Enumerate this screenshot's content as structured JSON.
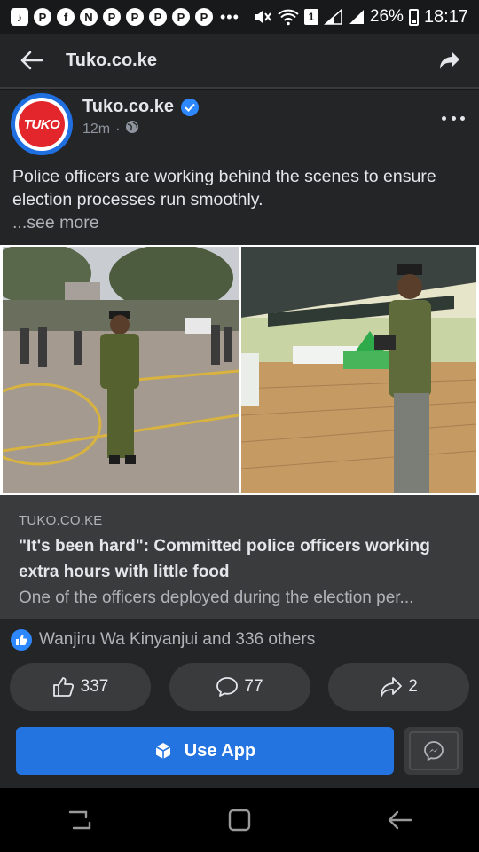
{
  "status_bar": {
    "left_icons": [
      "tiktok-icon",
      "p-icon",
      "facebook-icon",
      "n-icon",
      "p-icon",
      "p-icon",
      "p-icon",
      "p-icon",
      "p-icon"
    ],
    "overflow": "•••",
    "sim": "1",
    "battery": "26%",
    "time": "18:17"
  },
  "header": {
    "title": "Tuko.co.ke"
  },
  "post": {
    "avatar_text": "TUKO",
    "page_name": "Tuko.co.ke",
    "time": "12m",
    "caption": "Police officers are working behind the scenes to ensure election processes run smoothly.",
    "see_more": "...see more",
    "link": {
      "domain": "TUKO.CO.KE",
      "title": "\"It's been hard\": Committed police officers working extra hours with little food",
      "description": "One of the officers deployed during the election per..."
    },
    "reactions_text": "Wanjiru Wa Kinyanjui and 336 others",
    "likes": "337",
    "comments": "77",
    "shares": "2"
  },
  "app_bar": {
    "use_app_label": "Use App"
  },
  "colors": {
    "background": "#18191a",
    "surface": "#242526",
    "button": "#3a3b3c",
    "accent": "#2374e1",
    "brand_red": "#e3262c"
  }
}
